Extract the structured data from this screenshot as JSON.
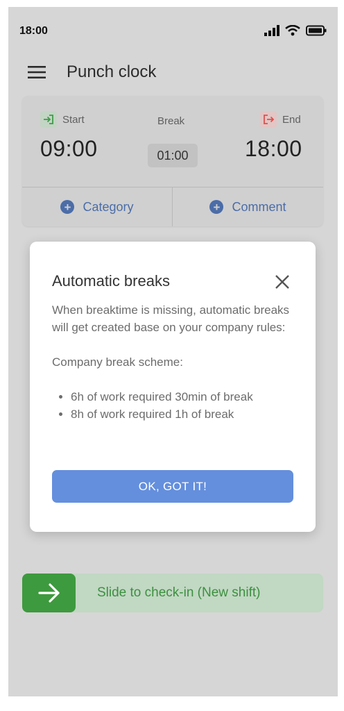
{
  "status_bar": {
    "time": "18:00"
  },
  "app_bar": {
    "title": "Punch clock"
  },
  "punch_card": {
    "start": {
      "label": "Start",
      "time": "09:00"
    },
    "break": {
      "label": "Break",
      "duration": "01:00"
    },
    "end": {
      "label": "End",
      "time": "18:00"
    },
    "actions": {
      "category": "Category",
      "comment": "Comment"
    }
  },
  "dialog": {
    "title": "Automatic breaks",
    "description": "When breaktime is missing, automatic breaks will get created base on your company rules:",
    "scheme_heading": "Company break scheme:",
    "rules": [
      "6h of work required 30min of break",
      "8h of work required 1h of break"
    ],
    "confirm_label": "OK, GOT IT!"
  },
  "slider": {
    "label": "Slide to check-in (New shift)"
  },
  "colors": {
    "accent_blue": "#648fdd",
    "action_blue": "#4b6da8",
    "success_green": "#3e9a3e",
    "end_red": "#d9534f",
    "start_green": "#3f9a4a"
  }
}
